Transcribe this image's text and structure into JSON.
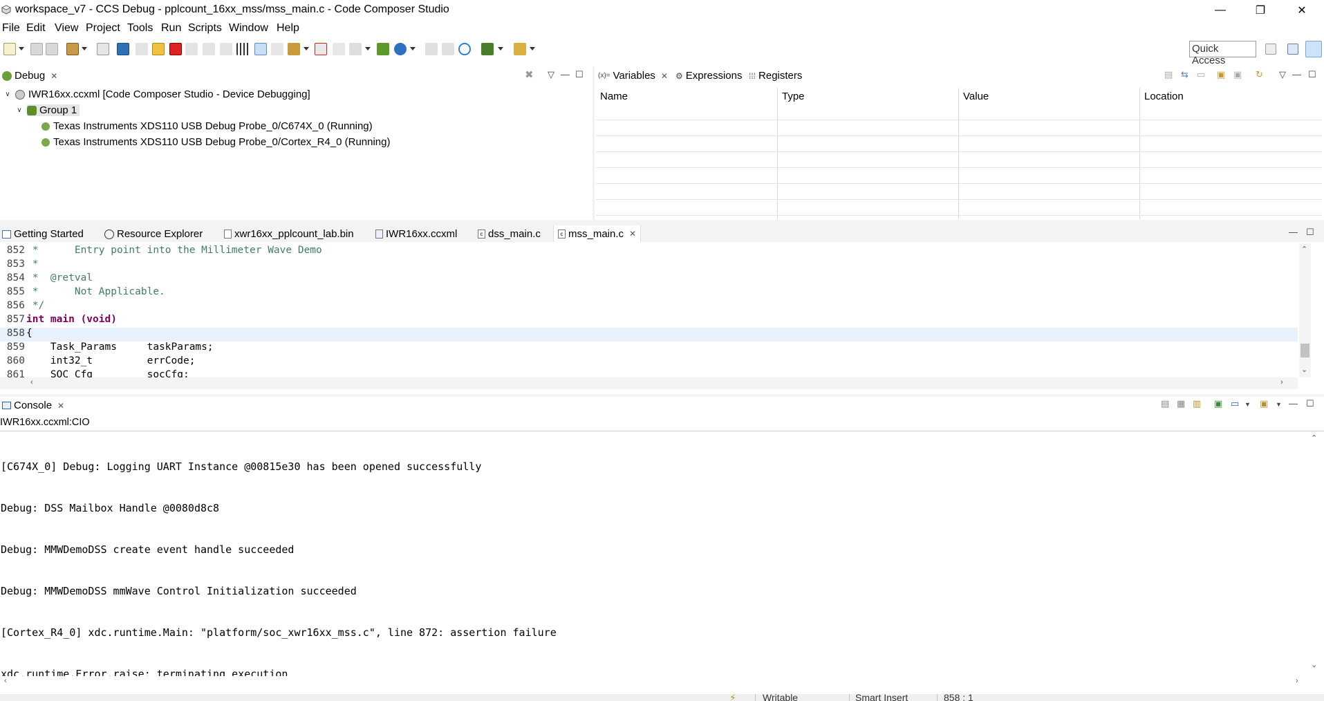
{
  "window": {
    "title": "workspace_v7 - CCS Debug - pplcount_16xx_mss/mss_main.c - Code Composer Studio",
    "minimize_glyph": "—",
    "restore_glyph": "❐",
    "close_glyph": "✕"
  },
  "menu": [
    "File",
    "Edit",
    "View",
    "Project",
    "Tools",
    "Run",
    "Scripts",
    "Window",
    "Help"
  ],
  "toolbar": {
    "quick_access": "Quick Access"
  },
  "debug_view": {
    "tab_label": "Debug",
    "items": [
      {
        "label": "IWR16xx.ccxml [Code Composer Studio - Device Debugging]"
      },
      {
        "label": "Group 1"
      },
      {
        "label": "Texas Instruments XDS110 USB Debug Probe_0/C674X_0 (Running)"
      },
      {
        "label": "Texas Instruments XDS110 USB Debug Probe_0/Cortex_R4_0 (Running)"
      }
    ]
  },
  "variables_view": {
    "tabs": [
      "Variables",
      "Expressions",
      "Registers"
    ],
    "variables_prefix": "(x)=",
    "columns": [
      "Name",
      "Type",
      "Value",
      "Location"
    ]
  },
  "editor": {
    "tabs": [
      "Getting Started",
      "Resource Explorer",
      "xwr16xx_pplcount_lab.bin",
      "IWR16xx.ccxml",
      "dss_main.c",
      "mss_main.c"
    ],
    "lines": [
      {
        "num": "852",
        "text": " *      Entry point into the Millimeter Wave Demo",
        "kind": "comment"
      },
      {
        "num": "853",
        "text": " *",
        "kind": "comment"
      },
      {
        "num": "854",
        "text": " *  @retval",
        "kind": "comment"
      },
      {
        "num": "855",
        "text": " *      Not Applicable.",
        "kind": "comment"
      },
      {
        "num": "856",
        "text": " */",
        "kind": "comment"
      },
      {
        "num": "857",
        "text": "int main (void)",
        "kind": "code"
      },
      {
        "num": "858",
        "text": "{",
        "kind": "code"
      },
      {
        "num": "859",
        "text": "    Task_Params     taskParams;",
        "kind": "code"
      },
      {
        "num": "860",
        "text": "    int32_t         errCode;",
        "kind": "code"
      },
      {
        "num": "861",
        "text": "    SOC_Cfg         socCfg;",
        "kind": "code"
      }
    ]
  },
  "console": {
    "tab_label": "Console",
    "session": "IWR16xx.ccxml:CIO",
    "lines": [
      "[C674X_0] Debug: Logging UART Instance @00815e30 has been opened successfully",
      "Debug: DSS Mailbox Handle @0080d8c8",
      "Debug: MMWDemoDSS create event handle succeeded",
      "Debug: MMWDemoDSS mmWave Control Initialization succeeded",
      "[Cortex_R4_0] xdc.runtime.Main: \"platform/soc_xwr16xx_mss.c\", line 872: assertion failure",
      "xdc.runtime.Error.raise: terminating execution"
    ]
  },
  "status": {
    "writable": "Writable",
    "insert_mode": "Smart Insert",
    "position": "858 : 1"
  },
  "colors": {
    "tab_active_bg": "#ffffff",
    "tab_bar_bg": "#f3f3f3",
    "current_line": "#e8f2fe",
    "comment": "#3f7f5f",
    "keyword": "#7f0055"
  }
}
